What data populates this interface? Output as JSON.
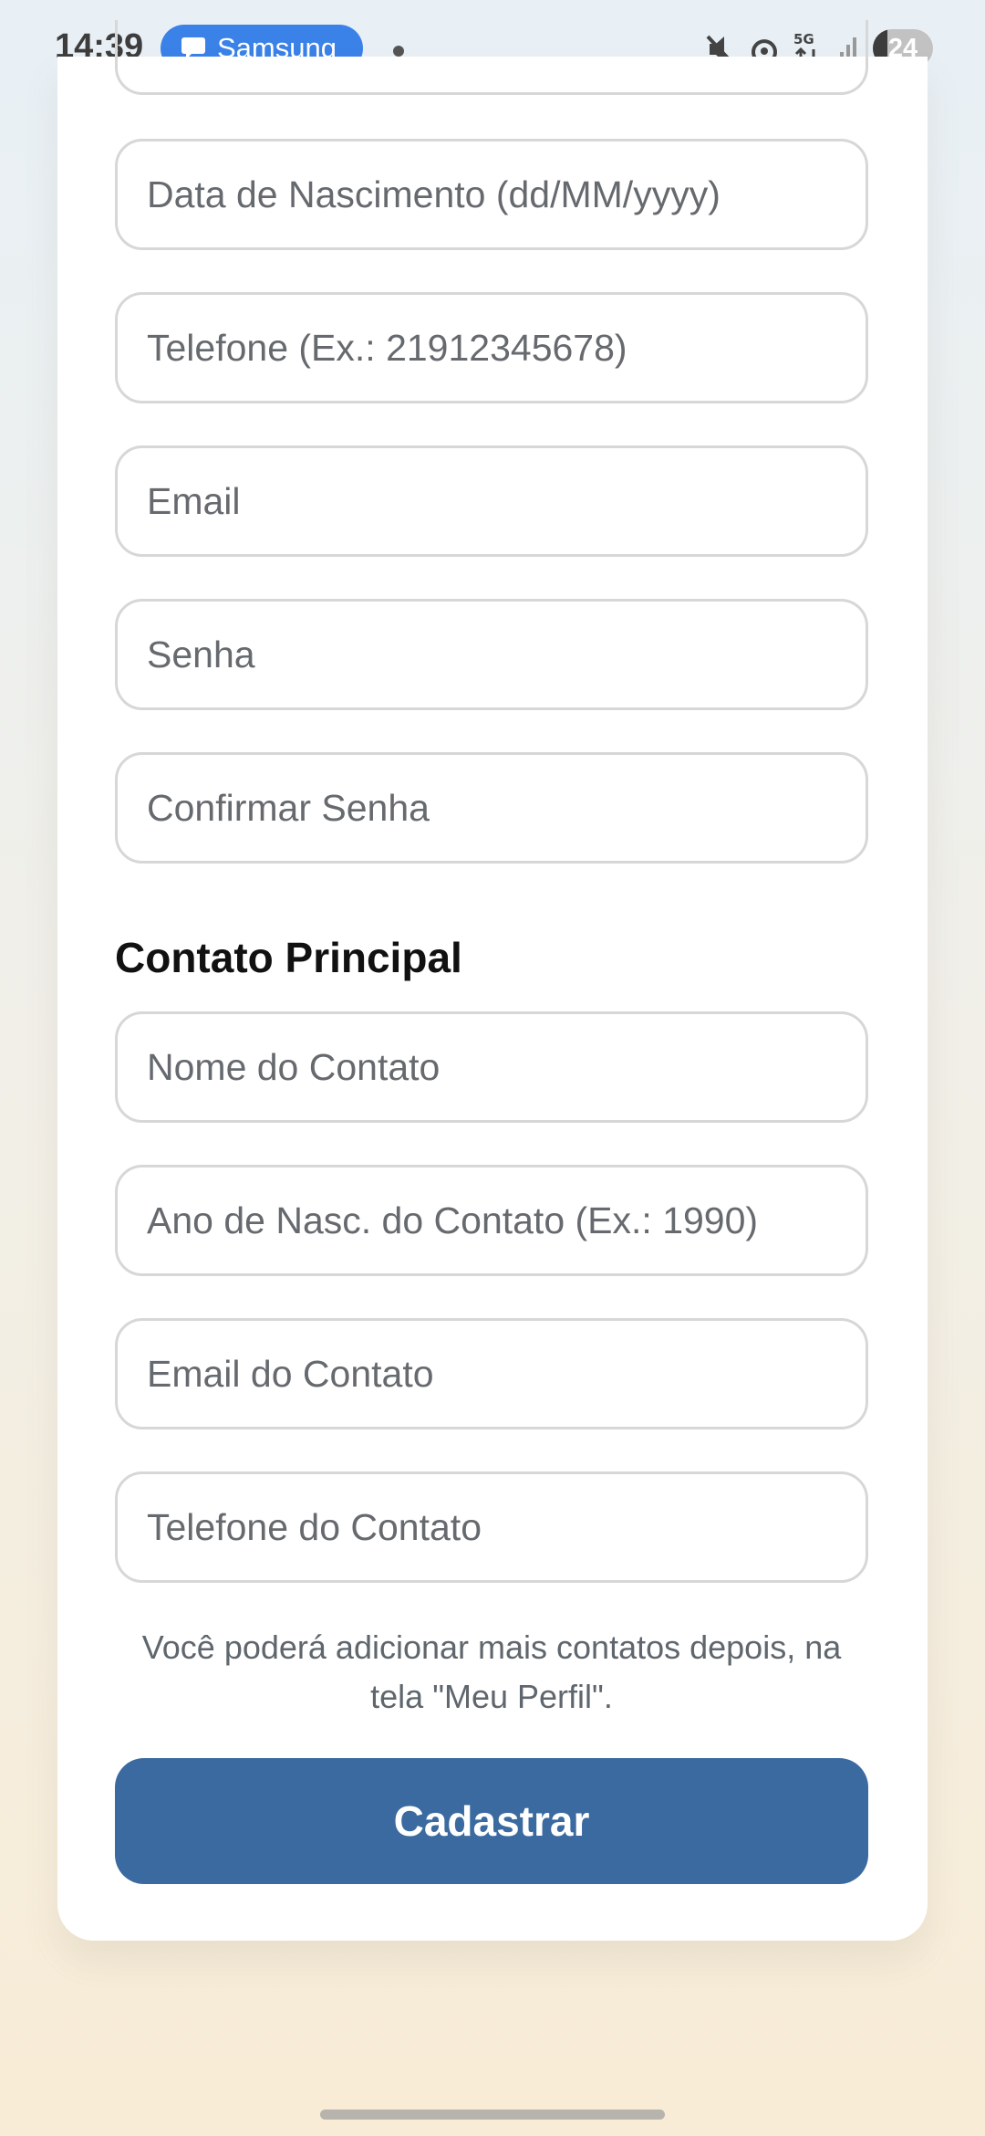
{
  "status_bar": {
    "time": "14:39",
    "notification_label": "Samsung",
    "battery": "24"
  },
  "form": {
    "fields": [
      {
        "placeholder": "Data de Nascimento (dd/MM/yyyy)"
      },
      {
        "placeholder": "Telefone (Ex.: 21912345678)"
      },
      {
        "placeholder": "Email"
      },
      {
        "placeholder": "Senha"
      },
      {
        "placeholder": "Confirmar Senha"
      }
    ],
    "contact_section_title": "Contato Principal",
    "contact_fields": [
      {
        "placeholder": "Nome do Contato"
      },
      {
        "placeholder": "Ano de Nasc. do Contato (Ex.: 1990)"
      },
      {
        "placeholder": "Email do Contato"
      },
      {
        "placeholder": "Telefone do Contato"
      }
    ],
    "helper_text": "Você poderá adicionar mais contatos depois, na tela \"Meu Perfil\".",
    "submit_label": "Cadastrar"
  },
  "colors": {
    "primary_button": "#3a6aa0",
    "notification_pill": "#3a82e8"
  }
}
